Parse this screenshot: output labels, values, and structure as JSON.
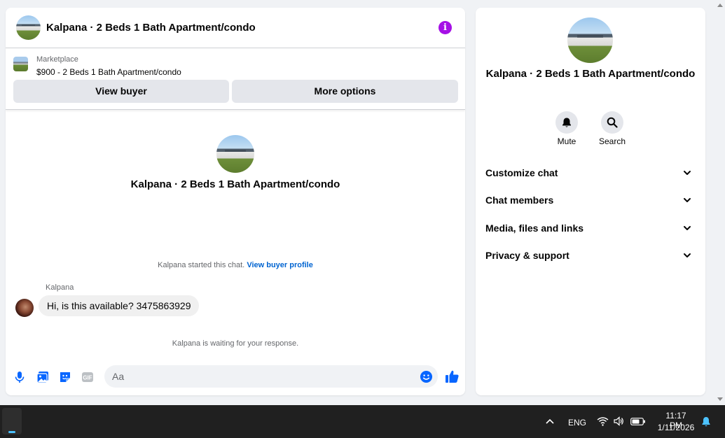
{
  "chat": {
    "title": "Kalpana · 2 Beds 1 Bath Apartment/condo",
    "info_glyph": "i",
    "marketplace": {
      "label": "Marketplace",
      "item": "$900 - 2 Beds 1 Bath Apartment/condo",
      "view_buyer": "View buyer",
      "more_options": "More options"
    },
    "conversation_name": "Kalpana · 2 Beds 1 Bath Apartment/condo",
    "started_text": "Kalpana started this chat.",
    "view_buyer_profile": "View buyer profile",
    "sender": "Kalpana",
    "message": "Hi, is this available? 3475863929",
    "waiting": "Kalpana is waiting for your response.",
    "input_placeholder": "Aa",
    "composer_icons": [
      "microphone-icon",
      "gallery-icon",
      "sticker-icon",
      "gif-icon",
      "emoji-icon",
      "thumbs-up-icon"
    ],
    "accent_color": "#0866ff",
    "info_color": "#a50fe6"
  },
  "info": {
    "title": "Kalpana · 2 Beds 1 Bath Apartment/condo",
    "mute": "Mute",
    "search": "Search",
    "sections": [
      "Customize chat",
      "Chat members",
      "Media, files and links",
      "Privacy & support"
    ]
  },
  "taskbar": {
    "language": "ENG",
    "time": "11:17 PM",
    "date": "1/11/2026"
  }
}
